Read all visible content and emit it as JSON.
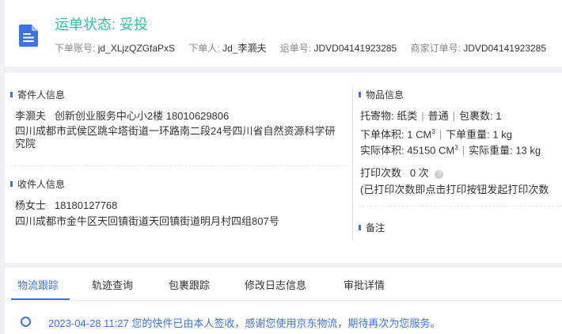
{
  "header": {
    "status_label": "运单状态:",
    "status_value": "妥投",
    "order_account_label": "下单账号:",
    "order_account_value": "jd_XLjzQZGfaPxS",
    "orderer_label": "下单人:",
    "orderer_value": "Jd_李灏夫",
    "waybill_label": "运单号:",
    "waybill_value": "JDVD04141923285",
    "merchant_order_label": "商家订单号:",
    "merchant_order_value": "JDVD04141923285"
  },
  "sender": {
    "title": "寄件人信息",
    "name": "李灏夫",
    "company": "创新创业服务中心小2楼",
    "phone": "18010629806",
    "address": "四川成都市武侯区跳伞塔街道一环路南二段24号四川省自然资源科学研究院"
  },
  "receiver": {
    "title": "收件人信息",
    "name": "杨女士",
    "phone": "18180127768",
    "address": "四川成都市金牛区天回镇街道天回镇街道明月村四组807号"
  },
  "goods": {
    "title": "物品信息",
    "consign_label": "托寄物:",
    "consign_type": "纸类",
    "service": "普通",
    "pkg_count_label": "包裹数:",
    "pkg_count": "1",
    "order_volume_label": "下单体积:",
    "order_volume": "1 CM",
    "order_weight_label": "下单重量:",
    "order_weight": "1 kg",
    "actual_volume_label": "实际体积:",
    "actual_volume": "45150 CM",
    "actual_weight_label": "实际重量:",
    "actual_weight": "13 kg",
    "volume_exp": "3",
    "print_label": "打印次数",
    "print_count": "0 次",
    "print_note": "(已打印次数即点击打印按钮发起打印次数"
  },
  "remarks": {
    "title": "备注"
  },
  "tabs": [
    {
      "label": "物流跟踪"
    },
    {
      "label": "轨迹查询"
    },
    {
      "label": "包裹跟踪"
    },
    {
      "label": "修改日志信息"
    },
    {
      "label": "审批详情"
    }
  ],
  "tracking": {
    "time": "2023-04-28 11:27",
    "message": "您的快件已由本人签收，感谢您使用京东物流，期待再次为您服务。"
  },
  "colors": {
    "accent": "#3b73e6",
    "status": "#2fc3a8"
  },
  "icons": {
    "document": "document-icon",
    "help": "help-icon",
    "timeline": "timeline-dot-icon"
  }
}
